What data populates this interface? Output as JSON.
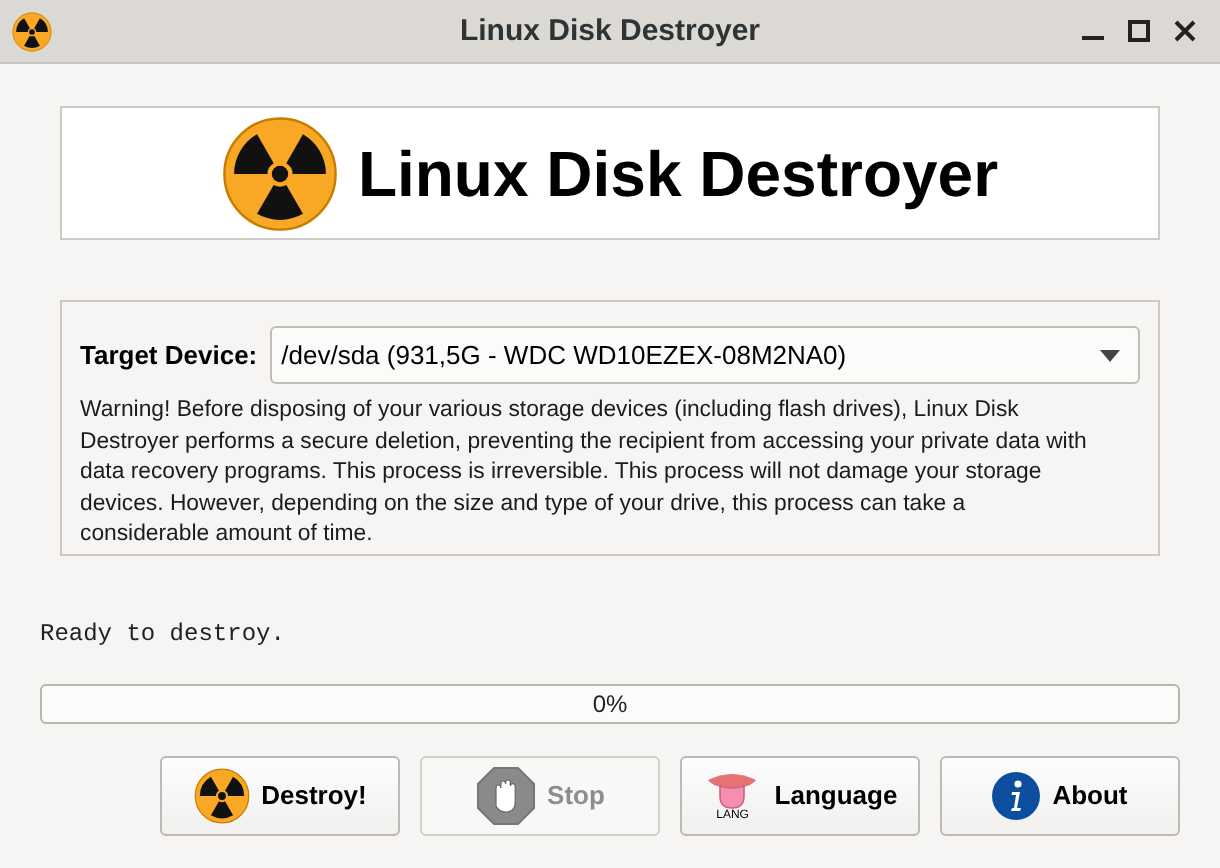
{
  "window": {
    "title": "Linux Disk Destroyer"
  },
  "banner": {
    "title": "Linux Disk Destroyer"
  },
  "device": {
    "label": "Target Device:",
    "value": "/dev/sda (931,5G - WDC WD10EZEX-08M2NA0)"
  },
  "warning": "Warning! Before disposing of your various storage devices (including flash drives), Linux Disk Destroyer performs a secure deletion, preventing the recipient from accessing your private data with data recovery programs. This process is irreversible. This process will not damage your storage devices. However, depending on the size and type of your drive, this process can take a considerable amount of time.",
  "status": "Ready to destroy.",
  "progress": {
    "level": 0,
    "reading": "0%"
  },
  "buttons": [
    {
      "label": "Destroy!",
      "kind": "destroy",
      "disabled": false
    },
    {
      "label": "Stop",
      "kind": "stop",
      "disabled": true
    },
    {
      "label": "Language",
      "kind": "language",
      "disabled": false,
      "icon_caption": "LANG"
    },
    {
      "label": "About",
      "kind": "about",
      "disabled": false
    }
  ]
}
